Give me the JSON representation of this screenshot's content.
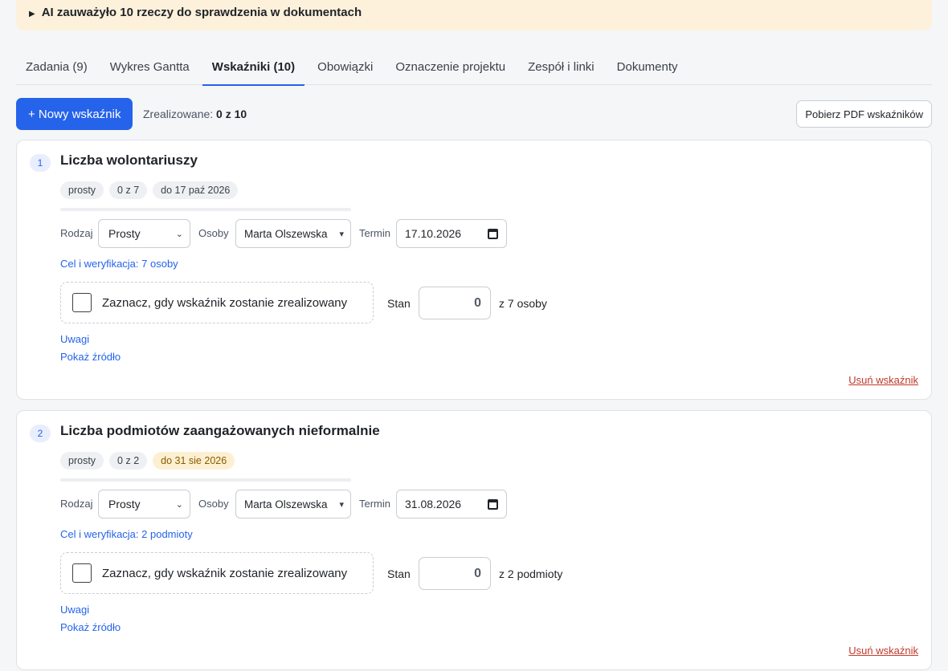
{
  "ai_banner": {
    "toggle_icon": "▶",
    "text": "AI zauważyło 10 rzeczy do sprawdzenia w dokumentach"
  },
  "tabs": [
    {
      "label": "Zadania (9)"
    },
    {
      "label": "Wykres Gantta"
    },
    {
      "label": "Wskaźniki (10)",
      "active": true
    },
    {
      "label": "Obowiązki"
    },
    {
      "label": "Oznaczenie projektu"
    },
    {
      "label": "Zespół i linki"
    },
    {
      "label": "Dokumenty"
    }
  ],
  "toolbar": {
    "new_label": "+ Nowy wskaźnik",
    "realized_label": "Zrealizowane:",
    "realized_value": "0 z 10",
    "pdf_label": "Pobierz PDF wskaźników"
  },
  "colors": {
    "accent": "#2563eb",
    "danger": "#c0392b",
    "banner_bg": "#fdf1db"
  },
  "indicators": [
    {
      "number": "1",
      "title": "Liczba wolontariuszy",
      "badges": {
        "type": "prosty",
        "count": "0 z 7",
        "due": "do 17 paź 2026"
      },
      "progress": 0,
      "field_type_label": "Rodzaj",
      "field_type_value": "Prosty",
      "field_people_label": "Osoby",
      "field_people_value": "Marta Olszewska",
      "field_due_label": "Termin",
      "field_due_value": "17.10.2026",
      "goal_link": "Cel i weryfikacja: 7 osoby",
      "checkbox_label": "Zaznacz, gdy wskaźnik zostanie zrealizowany",
      "stan_label": "Stan",
      "stan_value": "0",
      "stan_of": "z 7 osoby",
      "notes_link": "Uwagi",
      "source_link": "Pokaż źródło",
      "delete_link": "Usuń wskaźnik"
    },
    {
      "number": "2",
      "title": "Liczba podmiotów zaangażowanych nieformalnie",
      "badges": {
        "type": "prosty",
        "count": "0 z 2",
        "due": "do 31 sie 2026"
      },
      "progress": 0,
      "field_type_label": "Rodzaj",
      "field_type_value": "Prosty",
      "field_people_label": "Osoby",
      "field_people_value": "Marta Olszewska",
      "field_due_label": "Termin",
      "field_due_value": "31.08.2026",
      "goal_link": "Cel i weryfikacja: 2 podmioty",
      "checkbox_label": "Zaznacz, gdy wskaźnik zostanie zrealizowany",
      "stan_label": "Stan",
      "stan_value": "0",
      "stan_of": "z 2 podmioty",
      "notes_link": "Uwagi",
      "source_link": "Pokaż źródło",
      "delete_link": "Usuń wskaźnik"
    }
  ]
}
